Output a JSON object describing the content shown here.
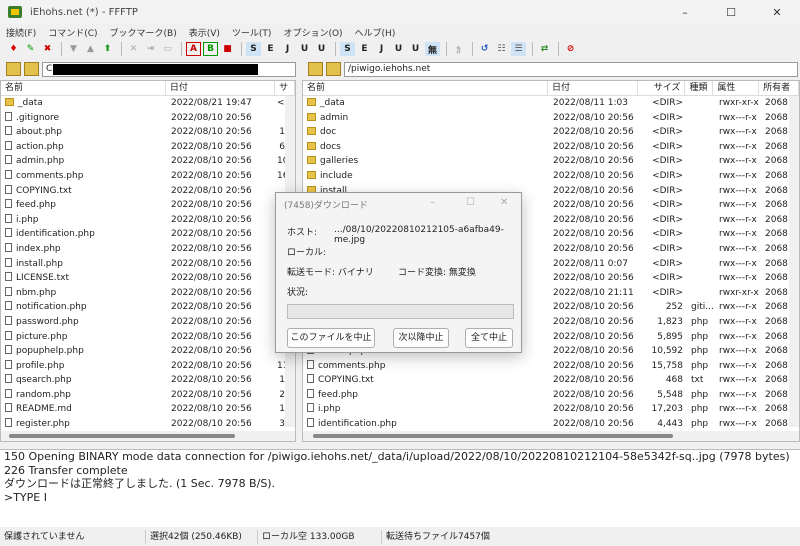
{
  "window": {
    "title": "iEhohs.net (*) - FFFTP",
    "controls": [
      "–",
      "☐",
      "✕"
    ]
  },
  "menu": [
    "接続(F)",
    "コマンド(C)",
    "ブックマーク(B)",
    "表示(V)",
    "ツール(T)",
    "オプション(O)",
    "ヘルプ(H)"
  ],
  "local": {
    "path": "C",
    "columns": [
      "名前",
      "日付",
      "サ"
    ],
    "rows": [
      {
        "name": "_data",
        "date": "2022/08/21 19:47",
        "size": "<D",
        "folder": true
      },
      {
        "name": ".gitignore",
        "date": "2022/08/10 20:56",
        "size": "",
        "folder": false
      },
      {
        "name": "about.php",
        "date": "2022/08/10 20:56",
        "size": "1",
        "folder": false
      },
      {
        "name": "action.php",
        "date": "2022/08/10 20:56",
        "size": "6",
        "folder": false
      },
      {
        "name": "admin.php",
        "date": "2022/08/10 20:56",
        "size": "10",
        "folder": false
      },
      {
        "name": "comments.php",
        "date": "2022/08/10 20:56",
        "size": "16",
        "folder": false
      },
      {
        "name": "COPYING.txt",
        "date": "2022/08/10 20:56",
        "size": "",
        "folder": false
      },
      {
        "name": "feed.php",
        "date": "2022/08/10 20:56",
        "size": "",
        "folder": false
      },
      {
        "name": "i.php",
        "date": "2022/08/10 20:56",
        "size": "",
        "folder": false
      },
      {
        "name": "identification.php",
        "date": "2022/08/10 20:56",
        "size": "",
        "folder": false
      },
      {
        "name": "index.php",
        "date": "2022/08/10 20:56",
        "size": "",
        "folder": false
      },
      {
        "name": "install.php",
        "date": "2022/08/10 20:56",
        "size": "",
        "folder": false
      },
      {
        "name": "LICENSE.txt",
        "date": "2022/08/10 20:56",
        "size": "",
        "folder": false
      },
      {
        "name": "nbm.php",
        "date": "2022/08/10 20:56",
        "size": "",
        "folder": false
      },
      {
        "name": "notification.php",
        "date": "2022/08/10 20:56",
        "size": "",
        "folder": false
      },
      {
        "name": "password.php",
        "date": "2022/08/10 20:56",
        "size": "",
        "folder": false
      },
      {
        "name": "picture.php",
        "date": "2022/08/10 20:56",
        "size": "2",
        "folder": false
      },
      {
        "name": "popuphelp.php",
        "date": "2022/08/10 20:56",
        "size": "",
        "folder": false
      },
      {
        "name": "profile.php",
        "date": "2022/08/10 20:56",
        "size": "11",
        "folder": false
      },
      {
        "name": "qsearch.php",
        "date": "2022/08/10 20:56",
        "size": "1",
        "folder": false
      },
      {
        "name": "random.php",
        "date": "2022/08/10 20:56",
        "size": "2",
        "folder": false
      },
      {
        "name": "README.md",
        "date": "2022/08/10 20:56",
        "size": "1",
        "folder": false
      },
      {
        "name": "register.php",
        "date": "2022/08/10 20:56",
        "size": "3",
        "folder": false
      }
    ]
  },
  "remote": {
    "path": "/piwigo.iehohs.net",
    "columns": [
      "名前",
      "日付",
      "サイズ",
      "種類",
      "属性",
      "所有者"
    ],
    "rows": [
      {
        "name": "_data",
        "date": "2022/08/11  1:03",
        "size": "<DIR>",
        "type": "",
        "attr": "rwxr-xr-x",
        "owner": "2068",
        "folder": true
      },
      {
        "name": "admin",
        "date": "2022/08/10 20:56",
        "size": "<DIR>",
        "type": "",
        "attr": "rwx---r-x",
        "owner": "2068",
        "folder": true
      },
      {
        "name": "doc",
        "date": "2022/08/10 20:56",
        "size": "<DIR>",
        "type": "",
        "attr": "rwx---r-x",
        "owner": "2068",
        "folder": true
      },
      {
        "name": "docs",
        "date": "2022/08/10 20:56",
        "size": "<DIR>",
        "type": "",
        "attr": "rwx---r-x",
        "owner": "2068",
        "folder": true
      },
      {
        "name": "galleries",
        "date": "2022/08/10 20:56",
        "size": "<DIR>",
        "type": "",
        "attr": "rwx---r-x",
        "owner": "2068",
        "folder": true
      },
      {
        "name": "include",
        "date": "2022/08/10 20:56",
        "size": "<DIR>",
        "type": "",
        "attr": "rwx---r-x",
        "owner": "2068",
        "folder": true
      },
      {
        "name": "install",
        "date": "2022/08/10 20:56",
        "size": "<DIR>",
        "type": "",
        "attr": "rwx---r-x",
        "owner": "2068",
        "folder": true
      },
      {
        "name": "",
        "date": "2022/08/10 20:56",
        "size": "<DIR>",
        "type": "",
        "attr": "rwx---r-x",
        "owner": "2068",
        "folder": true
      },
      {
        "name": "",
        "date": "2022/08/10 20:56",
        "size": "<DIR>",
        "type": "",
        "attr": "rwx---r-x",
        "owner": "2068",
        "folder": true
      },
      {
        "name": "",
        "date": "2022/08/10 20:56",
        "size": "<DIR>",
        "type": "",
        "attr": "rwx---r-x",
        "owner": "2068",
        "folder": true
      },
      {
        "name": "",
        "date": "2022/08/10 20:56",
        "size": "<DIR>",
        "type": "",
        "attr": "rwx---r-x",
        "owner": "2068",
        "folder": true
      },
      {
        "name": "",
        "date": "2022/08/11  0:07",
        "size": "<DIR>",
        "type": "",
        "attr": "rwx---r-x",
        "owner": "2068",
        "folder": true
      },
      {
        "name": "",
        "date": "2022/08/10 20:56",
        "size": "<DIR>",
        "type": "",
        "attr": "rwx---r-x",
        "owner": "2068",
        "folder": true
      },
      {
        "name": "",
        "date": "2022/08/10 21:11",
        "size": "<DIR>",
        "type": "",
        "attr": "rwxr-xr-x",
        "owner": "2068",
        "folder": true
      },
      {
        "name": "",
        "date": "2022/08/10 20:56",
        "size": "252",
        "type": "giti...",
        "attr": "rwx---r-x",
        "owner": "2068",
        "folder": false
      },
      {
        "name": "",
        "date": "2022/08/10 20:56",
        "size": "1,823",
        "type": "php",
        "attr": "rwx---r-x",
        "owner": "2068",
        "folder": false
      },
      {
        "name": "",
        "date": "2022/08/10 20:56",
        "size": "5,895",
        "type": "php",
        "attr": "rwx---r-x",
        "owner": "2068",
        "folder": false
      },
      {
        "name": "admin.php",
        "date": "2022/08/10 20:56",
        "size": "10,592",
        "type": "php",
        "attr": "rwx---r-x",
        "owner": "2068",
        "folder": false
      },
      {
        "name": "comments.php",
        "date": "2022/08/10 20:56",
        "size": "15,758",
        "type": "php",
        "attr": "rwx---r-x",
        "owner": "2068",
        "folder": false
      },
      {
        "name": "COPYING.txt",
        "date": "2022/08/10 20:56",
        "size": "468",
        "type": "txt",
        "attr": "rwx---r-x",
        "owner": "2068",
        "folder": false
      },
      {
        "name": "feed.php",
        "date": "2022/08/10 20:56",
        "size": "5,548",
        "type": "php",
        "attr": "rwx---r-x",
        "owner": "2068",
        "folder": false
      },
      {
        "name": "i.php",
        "date": "2022/08/10 20:56",
        "size": "17,203",
        "type": "php",
        "attr": "rwx---r-x",
        "owner": "2068",
        "folder": false
      },
      {
        "name": "identification.php",
        "date": "2022/08/10 20:56",
        "size": "4,443",
        "type": "php",
        "attr": "rwx---r-x",
        "owner": "2068",
        "folder": false
      }
    ]
  },
  "log": [
    "150 Opening BINARY mode data connection for /piwigo.iehohs.net/_data/i/upload/2022/08/10/20220810212104-58e5342f-sq..jpg (7978 bytes)",
    "226 Transfer complete",
    "ダウンロードは正常終了しました. (1 Sec. 7978 B/S).",
    ">TYPE I"
  ],
  "status": [
    "保護されていません",
    "選択42個  (250.46KB)",
    "ローカル空 133.00GB",
    "転送待ちファイル7457個"
  ],
  "dialog": {
    "title": "(7458)ダウンロード",
    "host_label": "ホスト:",
    "host_value": ".../08/10/20220810212105-a6afba49-me.jpg",
    "local_label": "ローカル:",
    "mode_label": "転送モード: バイナリ",
    "conv_label": "コード変換: 無変換",
    "status_label": "状況:",
    "progress": 0,
    "buttons": [
      "このファイルを中止",
      "次以降中止",
      "全て中止"
    ]
  }
}
